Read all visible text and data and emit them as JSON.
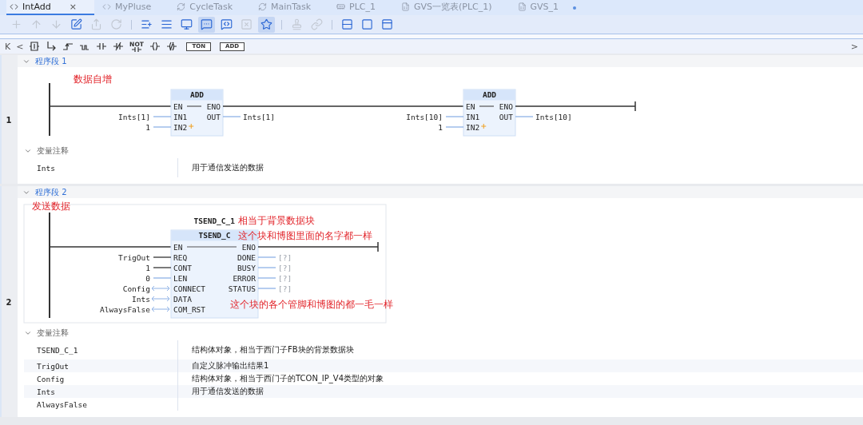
{
  "tabs": [
    {
      "label": "IntAdd",
      "kind": "code",
      "selected": true,
      "close": "×"
    },
    {
      "label": "MyPluse",
      "kind": "code",
      "selected": false
    },
    {
      "label": "CycleTask",
      "kind": "task",
      "selected": false
    },
    {
      "label": "MainTask",
      "kind": "task",
      "selected": false
    },
    {
      "label": "PLC_1",
      "kind": "device",
      "selected": false
    },
    {
      "label": "GVS一览表(PLC_1)",
      "kind": "table",
      "selected": false
    },
    {
      "label": "GVS_1",
      "kind": "table",
      "selected": false,
      "modified": true
    }
  ],
  "toolbar": [
    [
      {
        "disabled": true,
        "active": false
      },
      {
        "disabled": true,
        "active": false
      },
      {
        "disabled": true,
        "active": false
      },
      {
        "disabled": false,
        "active": false
      },
      {
        "disabled": true,
        "active": false
      },
      {
        "disabled": true,
        "active": false
      }
    ],
    [
      {
        "disabled": false,
        "active": false
      },
      {
        "disabled": false,
        "active": false
      },
      {
        "disabled": false,
        "active": false
      },
      {
        "disabled": false,
        "active": true
      },
      {
        "disabled": false,
        "active": false
      },
      {
        "disabled": true,
        "active": false
      },
      {
        "disabled": false,
        "active": true
      }
    ],
    [
      {
        "disabled": true,
        "active": false
      },
      {
        "disabled": true,
        "active": false
      }
    ],
    [
      {
        "disabled": false,
        "active": false
      },
      {
        "disabled": false,
        "active": false
      },
      {
        "disabled": false,
        "active": false
      }
    ]
  ],
  "instructions": {
    "nav": [
      "K",
      "<"
    ],
    "items": [
      {
        "kind": "box"
      },
      {
        "kind": "branch"
      },
      {
        "kind": "rise"
      },
      {
        "kind": "fall"
      },
      {
        "kind": "no"
      },
      {
        "kind": "nc"
      },
      {
        "kind": "not",
        "label": "NOT"
      },
      {
        "kind": "coil"
      },
      {
        "kind": "ncoil"
      }
    ],
    "boxes": [
      "TON",
      "ADD"
    ],
    "more": ">"
  },
  "networks": [
    {
      "title": "程序段 1",
      "number": "1",
      "expanded": true,
      "selected": false,
      "note": "数据自增",
      "blocks": [
        {
          "type": "ADD",
          "en": "EN",
          "eno": "ENO",
          "extensible": true,
          "inputs": [
            {
              "pin": "IN1",
              "value": "Ints[1]",
              "kind": "value"
            },
            {
              "pin": "IN2",
              "value": "1",
              "kind": "value"
            }
          ],
          "outputs": [
            {
              "pin": "OUT",
              "value": "Ints[1]",
              "kind": "value"
            }
          ]
        },
        {
          "type": "ADD",
          "en": "EN",
          "eno": "ENO",
          "extensible": true,
          "inputs": [
            {
              "pin": "IN1",
              "value": "Ints[10]",
              "kind": "value"
            },
            {
              "pin": "IN2",
              "value": "1",
              "kind": "value"
            }
          ],
          "outputs": [
            {
              "pin": "OUT",
              "value": "Ints[10]",
              "kind": "value"
            }
          ]
        }
      ],
      "comments": {
        "title": "变量注释",
        "expanded": true,
        "rows": [
          {
            "name": "Ints",
            "text": "用于通信发送的数据"
          }
        ]
      }
    },
    {
      "title": "程序段 2",
      "number": "2",
      "expanded": true,
      "selected": true,
      "note": "发送数据",
      "blocks": [
        {
          "type": "TSEND_C",
          "instance": "TSEND_C_1",
          "en": "EN",
          "eno": "ENO",
          "extensible": false,
          "notes": {
            "instance": "相当于背景数据块",
            "type": "这个块和博图里面的名字都一样",
            "pins": "这个块的各个管脚和博图的都一毛一样"
          },
          "inputs": [
            {
              "pin": "REQ",
              "value": "TrigOut",
              "kind": "bool"
            },
            {
              "pin": "CONT",
              "value": "1",
              "kind": "bool"
            },
            {
              "pin": "LEN",
              "value": "0",
              "kind": "value"
            },
            {
              "pin": "CONNECT",
              "value": "Config",
              "kind": "inout"
            },
            {
              "pin": "DATA",
              "value": "Ints",
              "kind": "inout"
            },
            {
              "pin": "COM_RST",
              "value": "AlwaysFalse",
              "kind": "inout"
            }
          ],
          "outputs": [
            {
              "pin": "DONE",
              "value": "[?]",
              "kind": "unassigned"
            },
            {
              "pin": "BUSY",
              "value": "[?]",
              "kind": "unassigned"
            },
            {
              "pin": "ERROR",
              "value": "[?]",
              "kind": "unassigned"
            },
            {
              "pin": "STATUS",
              "value": "[?]",
              "kind": "unassigned"
            }
          ]
        }
      ],
      "comments": {
        "title": "变量注释",
        "expanded": true,
        "rows": [
          {
            "name": "TSEND_C_1",
            "text": "结构体对象，相当于西门子FB块的背景数据块"
          },
          {
            "name": "TrigOut",
            "text": "自定义脉冲输出结果1"
          },
          {
            "name": "Config",
            "text": "结构体对象，相当于西门子的TCON_IP_V4类型的对象"
          },
          {
            "name": "Ints",
            "text": "用于通信发送的数据"
          },
          {
            "name": "AlwaysFalse"
          }
        ]
      }
    }
  ]
}
